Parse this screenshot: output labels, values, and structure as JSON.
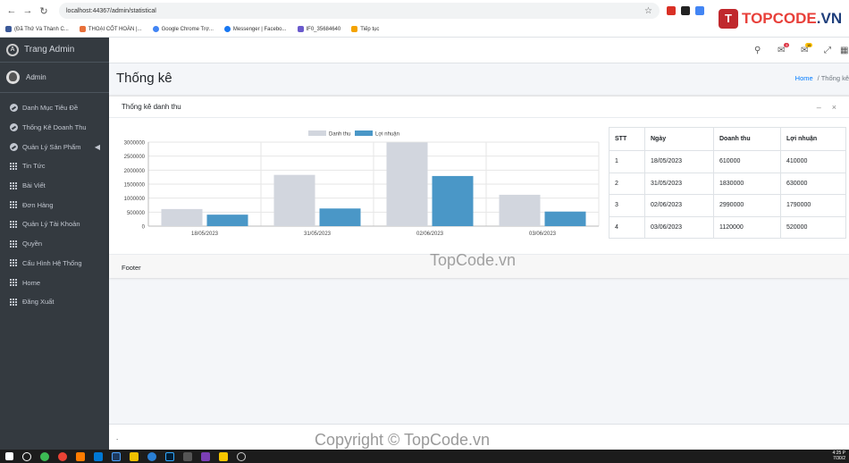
{
  "browser": {
    "url": "localhost:44367/admin/statistical",
    "bookmarks": [
      "(Đã Thử Và Thành C...",
      "THOẠI CỐT HOÀN |...",
      "Google Chrome Trợ...",
      "Messenger | Facebo...",
      "IF0_35684640",
      "Tiếp tục"
    ]
  },
  "brand": {
    "logo": "T",
    "name_a": "TOPCODE",
    "name_b": ".VN"
  },
  "sidebar": {
    "brand": "Trang Admin",
    "user": "Admin",
    "items": [
      {
        "label": "Danh Mục Tiêu Đề",
        "icon": "gauge-icon"
      },
      {
        "label": "Thống Kê Doanh Thu",
        "icon": "gauge-icon"
      },
      {
        "label": "Quản Lý Sản Phẩm",
        "icon": "gauge-icon"
      },
      {
        "label": "Tin Tức",
        "icon": "grid-icon"
      },
      {
        "label": "Bài Viết",
        "icon": "grid-icon"
      },
      {
        "label": "Đơn Hàng",
        "icon": "grid-icon"
      },
      {
        "label": "Quản Lý Tài Khoản",
        "icon": "grid-icon"
      },
      {
        "label": "Quyền",
        "icon": "grid-icon"
      },
      {
        "label": "Cấu Hình Hệ Thống",
        "icon": "grid-icon"
      },
      {
        "label": "Home",
        "icon": "grid-icon"
      },
      {
        "label": "Đăng Xuất",
        "icon": "grid-icon"
      }
    ]
  },
  "header": {
    "title": "Thống kê",
    "breadcrumb_home": "Home",
    "breadcrumb_current": "Thống kê"
  },
  "card": {
    "title": "Thống kê danh thu",
    "footer": "Footer"
  },
  "table": {
    "headers": [
      "STT",
      "Ngày",
      "Doanh thu",
      "Lợi nhuận"
    ],
    "rows": [
      [
        "1",
        "18/05/2023",
        "610000",
        "410000"
      ],
      [
        "2",
        "31/05/2023",
        "1830000",
        "630000"
      ],
      [
        "3",
        "02/06/2023",
        "2990000",
        "1790000"
      ],
      [
        "4",
        "03/06/2023",
        "1120000",
        "520000"
      ]
    ]
  },
  "chart_data": {
    "type": "bar",
    "categories": [
      "18/05/2023",
      "31/05/2023",
      "02/06/2023",
      "03/06/2023"
    ],
    "series": [
      {
        "name": "Danh thu",
        "values": [
          610000,
          1830000,
          2990000,
          1120000
        ],
        "color": "#d2d6de"
      },
      {
        "name": "Lợi nhuận",
        "values": [
          410000,
          630000,
          1790000,
          520000
        ],
        "color": "#4a97c7"
      }
    ],
    "yticks": [
      0,
      500000,
      1000000,
      1500000,
      2000000,
      2500000,
      3000000
    ],
    "ylim": [
      0,
      3000000
    ],
    "legend": "top-center",
    "grid": true
  },
  "main_footer": {
    "text": "."
  },
  "watermarks": {
    "center": "TopCode.vn",
    "bottom": "Copyright © TopCode.vn"
  },
  "clock": {
    "time": "4:25 P",
    "date": "7/30/2"
  }
}
